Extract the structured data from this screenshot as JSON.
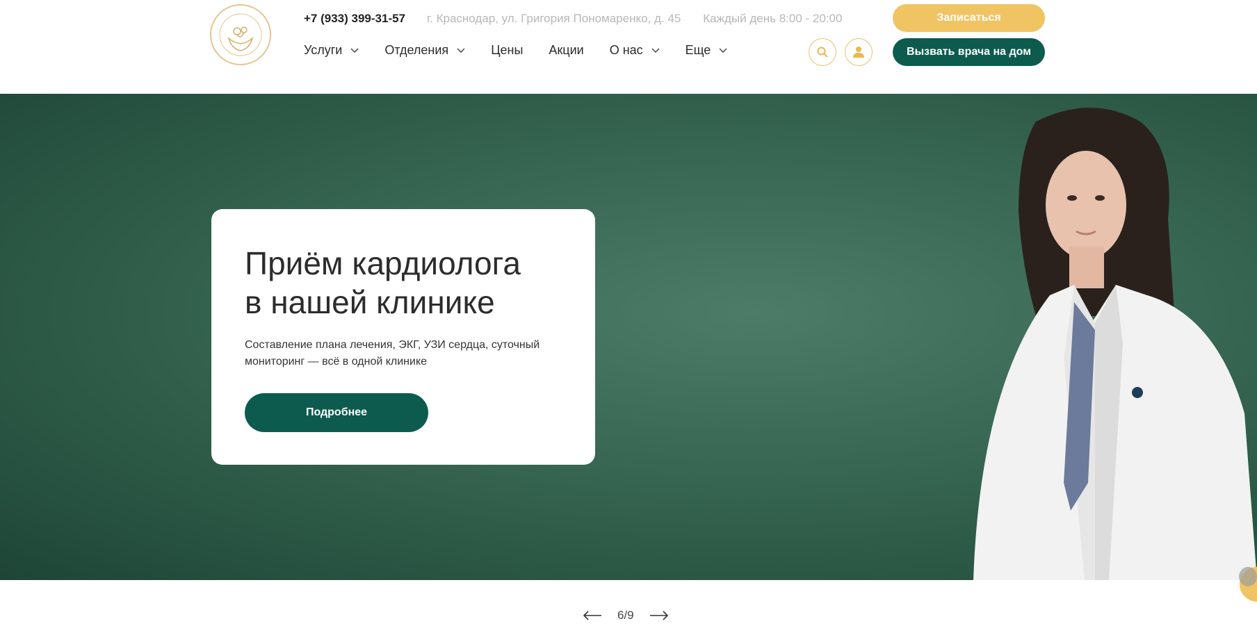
{
  "header": {
    "phone": "+7 (933) 399-31-57",
    "address": "г. Краснодар, ул. Григория Пономаренко, д. 45",
    "hours": "Каждый день 8:00 - 20:00",
    "sign_up": "Записаться",
    "call_doctor": "Вызвать врача на дом"
  },
  "nav": {
    "items": [
      {
        "label": "Услуги",
        "dropdown": true
      },
      {
        "label": "Отделения",
        "dropdown": true
      },
      {
        "label": "Цены",
        "dropdown": false
      },
      {
        "label": "Акции",
        "dropdown": false
      },
      {
        "label": "О нас",
        "dropdown": true
      },
      {
        "label": "Еще",
        "dropdown": true
      }
    ]
  },
  "hero": {
    "title_line1": "Приём кардиолога",
    "title_line2": "в нашей клинике",
    "text": "Составление плана лечения, ЭКГ, УЗИ сердца, суточный мониторинг — всё в одной клинике",
    "button": "Подробнее"
  },
  "slider": {
    "counter": "6/9"
  },
  "colors": {
    "accent_gold": "#f0c363",
    "brand_green": "#0d5b4f",
    "hero_bg": "#3b6b57"
  }
}
